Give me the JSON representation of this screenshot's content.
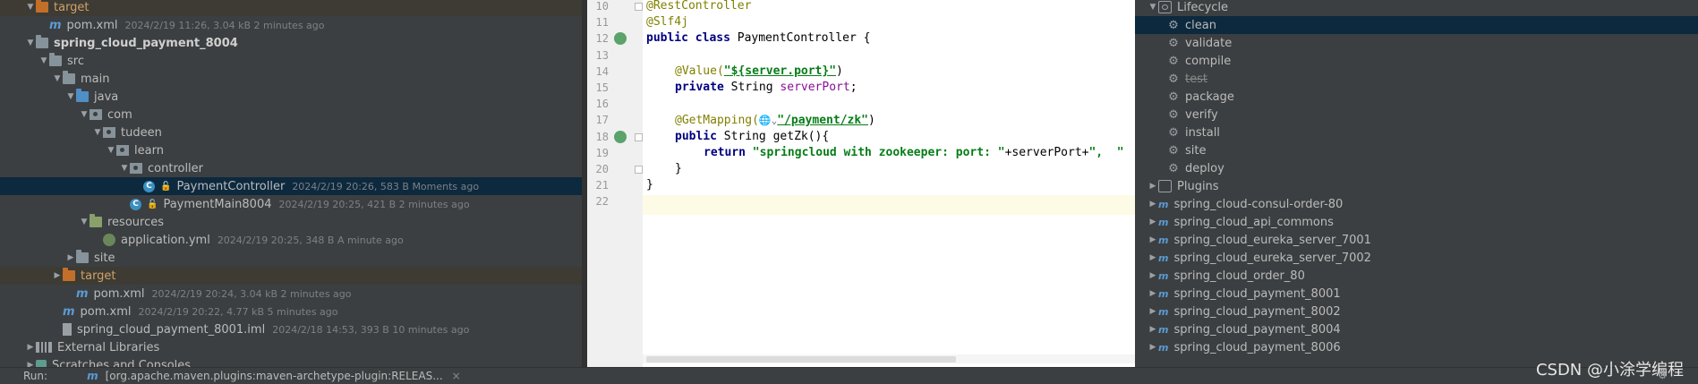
{
  "project_tree": [
    {
      "indent": 0,
      "arrow": "down",
      "icon": "folder-target",
      "name": "target",
      "style": "",
      "meta": "",
      "row": "excl"
    },
    {
      "indent": 1,
      "arrow": "",
      "icon": "pom",
      "name": "pom.xml",
      "style": "",
      "meta": "2024/2/19 11:26, 3.04 kB 2 minutes ago",
      "row": ""
    },
    {
      "indent": 0,
      "arrow": "down",
      "icon": "folder",
      "name": "spring_cloud_payment_8004",
      "style": "bold",
      "meta": "",
      "row": ""
    },
    {
      "indent": 1,
      "arrow": "down",
      "icon": "folder",
      "name": "src",
      "style": "",
      "meta": "",
      "row": ""
    },
    {
      "indent": 2,
      "arrow": "down",
      "icon": "folder",
      "name": "main",
      "style": "",
      "meta": "",
      "row": ""
    },
    {
      "indent": 3,
      "arrow": "down",
      "icon": "folder-src",
      "name": "java",
      "style": "",
      "meta": "",
      "row": ""
    },
    {
      "indent": 4,
      "arrow": "down",
      "icon": "pkg",
      "name": "com",
      "style": "",
      "meta": "",
      "row": ""
    },
    {
      "indent": 5,
      "arrow": "down",
      "icon": "pkg",
      "name": "tudeen",
      "style": "",
      "meta": "",
      "row": ""
    },
    {
      "indent": 6,
      "arrow": "down",
      "icon": "pkg",
      "name": "learn",
      "style": "",
      "meta": "",
      "row": ""
    },
    {
      "indent": 7,
      "arrow": "down",
      "icon": "pkg",
      "name": "controller",
      "style": "",
      "meta": "",
      "row": ""
    },
    {
      "indent": 8,
      "arrow": "",
      "icon": "cls",
      "name": "PaymentController",
      "style": "",
      "meta": "2024/2/19 20:26, 583 B Moments ago",
      "row": "sel"
    },
    {
      "indent": 7,
      "arrow": "",
      "icon": "cls",
      "name": "PaymentMain8004",
      "style": "",
      "meta": "2024/2/19 20:25, 421 B 2 minutes ago",
      "row": ""
    },
    {
      "indent": 4,
      "arrow": "down",
      "icon": "folder-res",
      "name": "resources",
      "style": "",
      "meta": "",
      "row": ""
    },
    {
      "indent": 5,
      "arrow": "",
      "icon": "yml",
      "name": "application.yml",
      "style": "",
      "meta": "2024/2/19 20:25, 348 B A minute ago",
      "row": ""
    },
    {
      "indent": 3,
      "arrow": "right",
      "icon": "folder",
      "name": "site",
      "style": "",
      "meta": "",
      "row": ""
    },
    {
      "indent": 2,
      "arrow": "right",
      "icon": "folder-target",
      "name": "target",
      "style": "",
      "meta": "",
      "row": "excl"
    },
    {
      "indent": 3,
      "arrow": "",
      "icon": "pom",
      "name": "pom.xml",
      "style": "",
      "meta": "2024/2/19 20:24, 3.04 kB 2 minutes ago",
      "row": ""
    },
    {
      "indent": 2,
      "arrow": "",
      "icon": "pom",
      "name": "pom.xml",
      "style": "",
      "meta": "2024/2/19 20:22, 4.77 kB 5 minutes ago",
      "row": ""
    },
    {
      "indent": 2,
      "arrow": "",
      "icon": "iml",
      "name": "spring_cloud_payment_8001.iml",
      "style": "",
      "meta": "2024/2/18 14:53, 393 B 10 minutes ago",
      "row": ""
    },
    {
      "indent": 0,
      "arrow": "right",
      "icon": "lib",
      "name": "External Libraries",
      "style": "",
      "meta": "",
      "row": ""
    },
    {
      "indent": 0,
      "arrow": "right",
      "icon": "scratch",
      "name": "Scratches and Consoles",
      "style": "",
      "meta": "",
      "row": ""
    }
  ],
  "editor": {
    "lines": [
      {
        "num": "10",
        "gutter_icon": false,
        "fold": "top"
      },
      {
        "num": "11",
        "gutter_icon": false,
        "fold": ""
      },
      {
        "num": "12",
        "gutter_icon": true,
        "fold": ""
      },
      {
        "num": "13",
        "gutter_icon": false,
        "fold": ""
      },
      {
        "num": "14",
        "gutter_icon": false,
        "fold": ""
      },
      {
        "num": "15",
        "gutter_icon": false,
        "fold": ""
      },
      {
        "num": "16",
        "gutter_icon": false,
        "fold": ""
      },
      {
        "num": "17",
        "gutter_icon": false,
        "fold": ""
      },
      {
        "num": "18",
        "gutter_icon": true,
        "fold": "top"
      },
      {
        "num": "19",
        "gutter_icon": false,
        "fold": ""
      },
      {
        "num": "20",
        "gutter_icon": false,
        "fold": "bottom"
      },
      {
        "num": "21",
        "gutter_icon": false,
        "fold": ""
      },
      {
        "num": "22",
        "gutter_icon": false,
        "fold": ""
      }
    ],
    "code": {
      "l10": "@RestController",
      "l11": "@Slf4j",
      "l12_kw": "public class ",
      "l12_rest": "PaymentController {",
      "l14_ann": "@Value(",
      "l14_str": "\"${server.port}\"",
      "l14_end": ")",
      "l15_kw": "private ",
      "l15_type": "String ",
      "l15_field": "serverPort",
      "l15_end": ";",
      "l17_ann": "@GetMapping(",
      "l17_web": "🌐⌄",
      "l17_str": "\"/payment/zk\"",
      "l17_end": ")",
      "l18_kw": "public ",
      "l18_rest": "String getZk(){",
      "l19_kw": "return ",
      "l19_str": "\"springcloud with zookeeper: port: \"",
      "l19_rest": "+serverPort+",
      "l19_str2": "\",  \"",
      "l20": "}",
      "l21": "}"
    }
  },
  "maven": {
    "rows": [
      {
        "indent": 0,
        "arrow": "down",
        "icon": "cycle",
        "label": "Lifecycle",
        "strike": false,
        "sel": false
      },
      {
        "indent": 1,
        "arrow": "",
        "icon": "gear",
        "label": "clean",
        "strike": false,
        "sel": true
      },
      {
        "indent": 1,
        "arrow": "",
        "icon": "gear",
        "label": "validate",
        "strike": false,
        "sel": false
      },
      {
        "indent": 1,
        "arrow": "",
        "icon": "gear",
        "label": "compile",
        "strike": false,
        "sel": false
      },
      {
        "indent": 1,
        "arrow": "",
        "icon": "gear",
        "label": "test",
        "strike": true,
        "sel": false
      },
      {
        "indent": 1,
        "arrow": "",
        "icon": "gear",
        "label": "package",
        "strike": false,
        "sel": false
      },
      {
        "indent": 1,
        "arrow": "",
        "icon": "gear",
        "label": "verify",
        "strike": false,
        "sel": false
      },
      {
        "indent": 1,
        "arrow": "",
        "icon": "gear",
        "label": "install",
        "strike": false,
        "sel": false
      },
      {
        "indent": 1,
        "arrow": "",
        "icon": "gear",
        "label": "site",
        "strike": false,
        "sel": false
      },
      {
        "indent": 1,
        "arrow": "",
        "icon": "gear",
        "label": "deploy",
        "strike": false,
        "sel": false
      },
      {
        "indent": 0,
        "arrow": "right",
        "icon": "plugin",
        "label": "Plugins",
        "strike": false,
        "sel": false
      },
      {
        "indent": 0,
        "arrow": "right",
        "icon": "maven",
        "label": "spring_cloud-consul-order-80",
        "strike": false,
        "sel": false
      },
      {
        "indent": 0,
        "arrow": "right",
        "icon": "maven",
        "label": "spring_cloud_api_commons",
        "strike": false,
        "sel": false
      },
      {
        "indent": 0,
        "arrow": "right",
        "icon": "maven",
        "label": "spring_cloud_eureka_server_7001",
        "strike": false,
        "sel": false
      },
      {
        "indent": 0,
        "arrow": "right",
        "icon": "maven",
        "label": "spring_cloud_eureka_server_7002",
        "strike": false,
        "sel": false
      },
      {
        "indent": 0,
        "arrow": "right",
        "icon": "maven",
        "label": "spring_cloud_order_80",
        "strike": false,
        "sel": false
      },
      {
        "indent": 0,
        "arrow": "right",
        "icon": "maven",
        "label": "spring_cloud_payment_8001",
        "strike": false,
        "sel": false
      },
      {
        "indent": 0,
        "arrow": "right",
        "icon": "maven",
        "label": "spring_cloud_payment_8002",
        "strike": false,
        "sel": false
      },
      {
        "indent": 0,
        "arrow": "right",
        "icon": "maven",
        "label": "spring_cloud_payment_8004",
        "strike": false,
        "sel": false
      },
      {
        "indent": 0,
        "arrow": "right",
        "icon": "maven",
        "label": "spring_cloud_payment_8006",
        "strike": false,
        "sel": false
      }
    ]
  },
  "bottom_bar": {
    "run_label": "Run:",
    "run_icon": "m",
    "run_tab": "[org.apache.maven.plugins:maven-archetype-plugin:RELEAS...",
    "close": "×"
  },
  "watermark": "CSDN @小涂学编程",
  "colors": {
    "selection": "#0d293e",
    "panel": "#3c3f41",
    "editor_bg": "#ffffff",
    "annotation": "#808000",
    "keyword": "#000080",
    "string": "#067d17",
    "field": "#871094"
  }
}
